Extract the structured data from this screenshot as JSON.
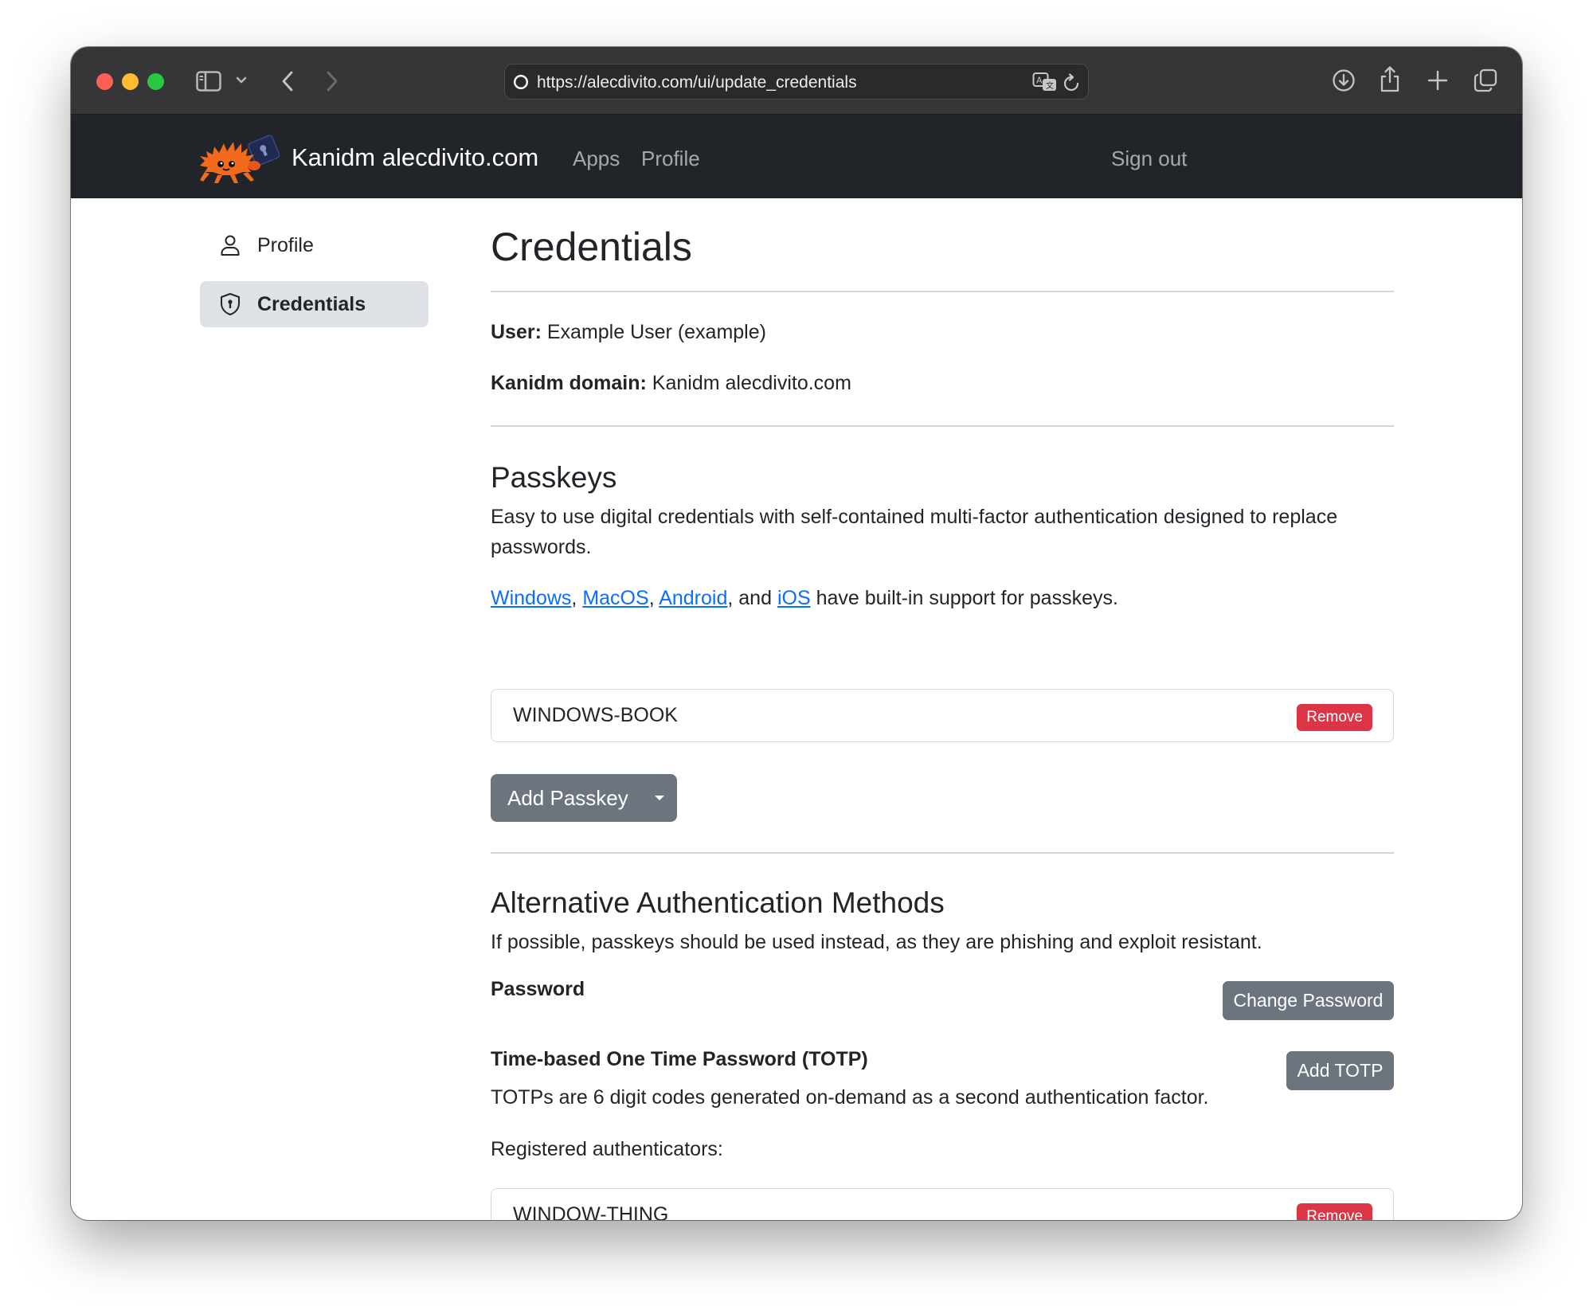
{
  "browser": {
    "url": "https://alecdivito.com/ui/update_credentials"
  },
  "navbar": {
    "brand": "Kanidm alecdivito.com",
    "links": [
      "Apps",
      "Profile"
    ],
    "sign_out": "Sign out"
  },
  "sidebar": {
    "items": [
      {
        "label": "Profile",
        "icon": "person-icon",
        "active": false
      },
      {
        "label": "Credentials",
        "icon": "shield-icon",
        "active": true
      }
    ]
  },
  "main": {
    "title": "Credentials",
    "user_label": "User:",
    "user_value": "Example User (example)",
    "domain_label": "Kanidm domain:",
    "domain_value": "Kanidm alecdivito.com",
    "passkeys": {
      "heading": "Passkeys",
      "description_line1": "Easy to use digital credentials with self-contained multi-factor authentication designed to replace",
      "description_line2": "passwords.",
      "platform_links": [
        "Windows",
        "MacOS",
        "Android",
        "iOS"
      ],
      "sep1": ", ",
      "sep2": ", ",
      "sep3": ", and ",
      "support_suffix": " have built-in support for passkeys.",
      "registered": [
        {
          "name": "WINDOWS-BOOK",
          "remove_label": "Remove"
        }
      ],
      "add_label": "Add Passkey"
    },
    "alternative": {
      "heading": "Alternative Authentication Methods",
      "description": "If possible, passkeys should be used instead, as they are phishing and exploit resistant.",
      "password_label": "Password",
      "change_password_label": "Change Password",
      "totp_heading": "Time-based One Time Password (TOTP)",
      "add_totp_label": "Add TOTP",
      "totp_description": "TOTPs are 6 digit codes generated on-demand as a second authentication factor.",
      "registered_label": "Registered authenticators:",
      "registered": [
        {
          "name": "WINDOW-THING",
          "remove_label": "Remove"
        }
      ]
    }
  },
  "colors": {
    "navbar_bg": "#212529",
    "link": "#0d6efd",
    "danger": "#dc3545",
    "secondary": "#6c757d",
    "active_bg": "#dee2e6"
  }
}
